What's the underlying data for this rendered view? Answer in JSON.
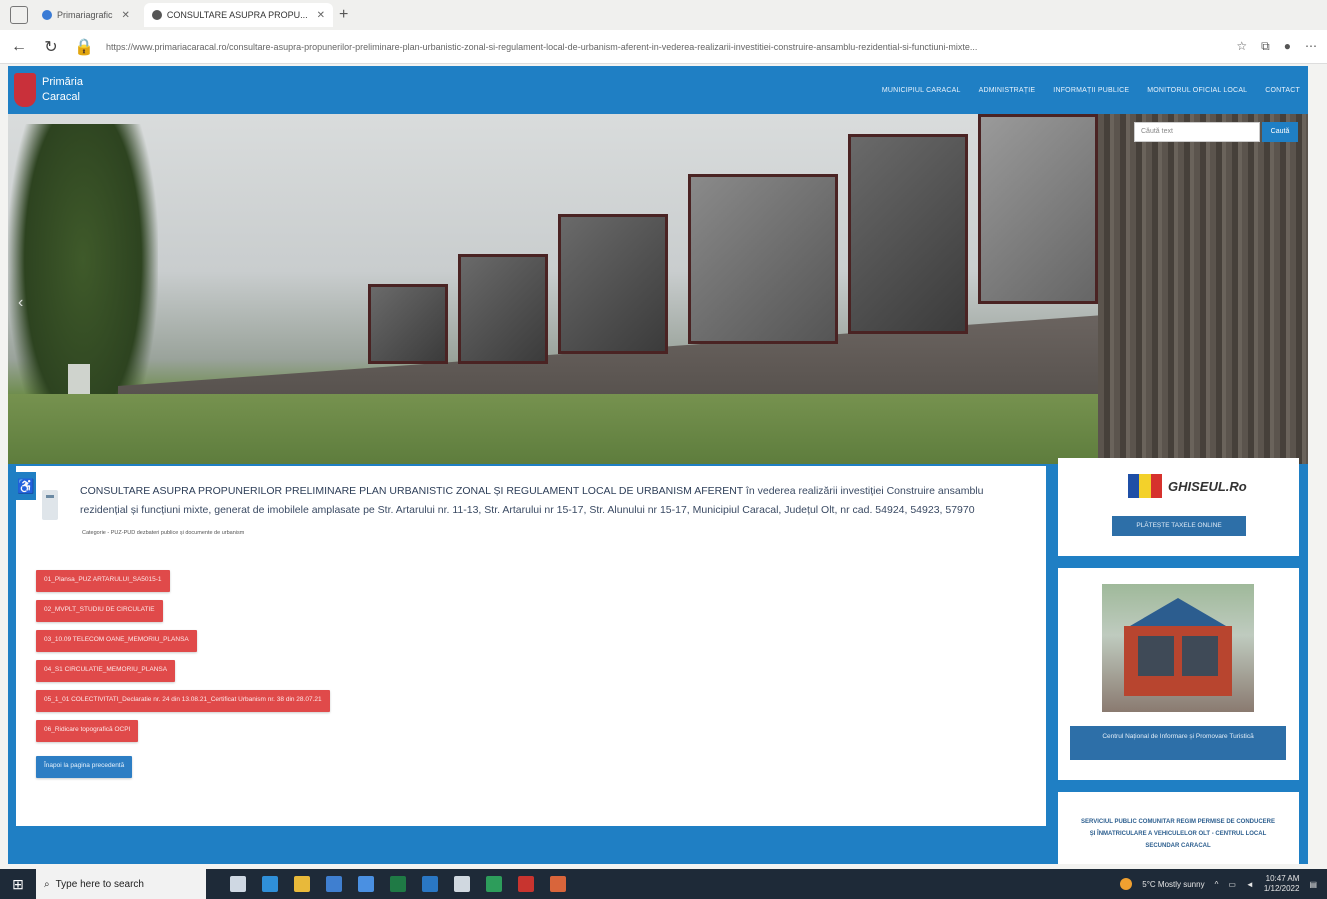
{
  "browser": {
    "tabs": [
      {
        "label": "Primariagrafic",
        "active": false
      },
      {
        "label": "CONSULTARE ASUPRA PROPU...",
        "active": true
      }
    ],
    "url_prefix": "https://www.primariacaracal.ro/consultare-asupra-propunerilor-preliminare-plan-urbanistic-zonal-si-regulament-local-de-urbanism-aferent-in-vederea-realizarii-investitiei-construire-ansamblu-rezidential-si-functiuni-mixte...",
    "url_domain": "www.primariacaracal.ro"
  },
  "header": {
    "logo_line1": "Primăria",
    "logo_line2": "Caracal",
    "nav": [
      "MUNICIPIUL CARACAL",
      "ADMINISTRAȚIE",
      "INFORMAȚII PUBLICE",
      "MONITORUL OFICIAL LOCAL",
      "CONTACT"
    ],
    "brand_color": "#1f7fc4"
  },
  "hero": {
    "search_placeholder": "Căută text",
    "search_button": "Caută",
    "prev_arrow": "‹"
  },
  "article": {
    "title_main": "CONSULTARE ASUPRA PROPUNERILOR PRELIMINARE PLAN URBANISTIC ZONAL ȘI REGULAMENT LOCAL DE URBANISM AFERENT",
    "title_rest": " în vederea realizării investiției Construire ansamblu rezidențial și funcțiuni mixte, generat de imobilele amplasate pe Str. Artarului nr. 11-13, Str. Artarului nr 15-17, Str. Alunului nr 15-17, Municipiul Caracal, Județul Olt, nr cad. 54924, 54923, 57970",
    "meta": "Categorie - PUZ-PUD dezbateri publice și documente de urbanism",
    "files": [
      "01_Plansa_PUZ ARTARULUI_SA5015-1",
      "02_MVPLT_STUDIU DE CIRCULATIE",
      "03_10.09 TELECOM OANE_MEMORIU_PLANSA",
      "04_S1 CIRCULATIE_MEMORIU_PLANSA",
      "05_1_01 COLECTIVITATI_Declaratie nr. 24 din 13.08.21_Certificat Urbanism nr. 38 din 28.07.21",
      "06_Ridicare topografică OCPI"
    ],
    "back_label": "Înapoi la pagina precedentă"
  },
  "sidebar": {
    "ghiseul_label": "GHISEUL.Ro",
    "pay_label": "PLĂTEȘTE TAXELE ONLINE",
    "info_label": "Centrul Național de Informare și Promovare Turistică",
    "service_text": "SERVICIUL PUBLIC COMUNITAR REGIM PERMISE DE CONDUCERE ȘI ÎNMATRICULARE A VEHICULELOR OLT - CENTRUL LOCAL SECUNDAR CARACAL",
    "flag_colors": [
      "#1f4fa6",
      "#f3d12a",
      "#d6322d"
    ]
  },
  "taskbar": {
    "search_placeholder": "Type here to search",
    "weather": "5°C Mostly sunny",
    "time": "10:47 AM",
    "date": "1/12/2022"
  }
}
